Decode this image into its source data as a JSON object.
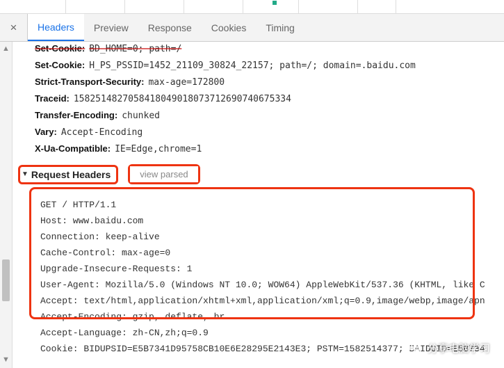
{
  "tabs": {
    "headers": "Headers",
    "preview": "Preview",
    "response": "Response",
    "cookies": "Cookies",
    "timing": "Timing"
  },
  "response_headers": [
    {
      "key": "Set-Cookie:",
      "val": "BD_HOME=0; path=/",
      "struck": true
    },
    {
      "key": "Set-Cookie:",
      "val": "H_PS_PSSID=1452_21109_30824_22157; path=/; domain=.baidu.com",
      "struck": false
    },
    {
      "key": "Strict-Transport-Security:",
      "val": "max-age=172800",
      "struck": false
    },
    {
      "key": "Traceid:",
      "val": "1582514827058418049018073712690740675334",
      "struck": false
    },
    {
      "key": "Transfer-Encoding:",
      "val": "chunked",
      "struck": false
    },
    {
      "key": "Vary:",
      "val": "Accept-Encoding",
      "struck": false
    },
    {
      "key": "X-Ua-Compatible:",
      "val": "IE=Edge,chrome=1",
      "struck": false
    }
  ],
  "request_section": {
    "title": "Request Headers",
    "view_parsed": "view parsed"
  },
  "request_raw": [
    "GET / HTTP/1.1",
    "Host: www.baidu.com",
    "Connection: keep-alive",
    "Cache-Control: max-age=0",
    "Upgrade-Insecure-Requests: 1",
    "User-Agent: Mozilla/5.0 (Windows NT 10.0; WOW64) AppleWebKit/537.36 (KHTML, like C",
    "Accept: text/html,application/xhtml+xml,application/xml;q=0.9,image/webp,image/apn",
    "Accept-Encoding: gzip, deflate, br",
    "Accept-Language: zh-CN,zh;q=0.9",
    "Cookie: BIDUPSID=E5B7341D95758CB10E6E28295E2143E3; PSTM=1582514377; BAIDUID=E5B734"
  ],
  "watermark": "分享电脑学习"
}
